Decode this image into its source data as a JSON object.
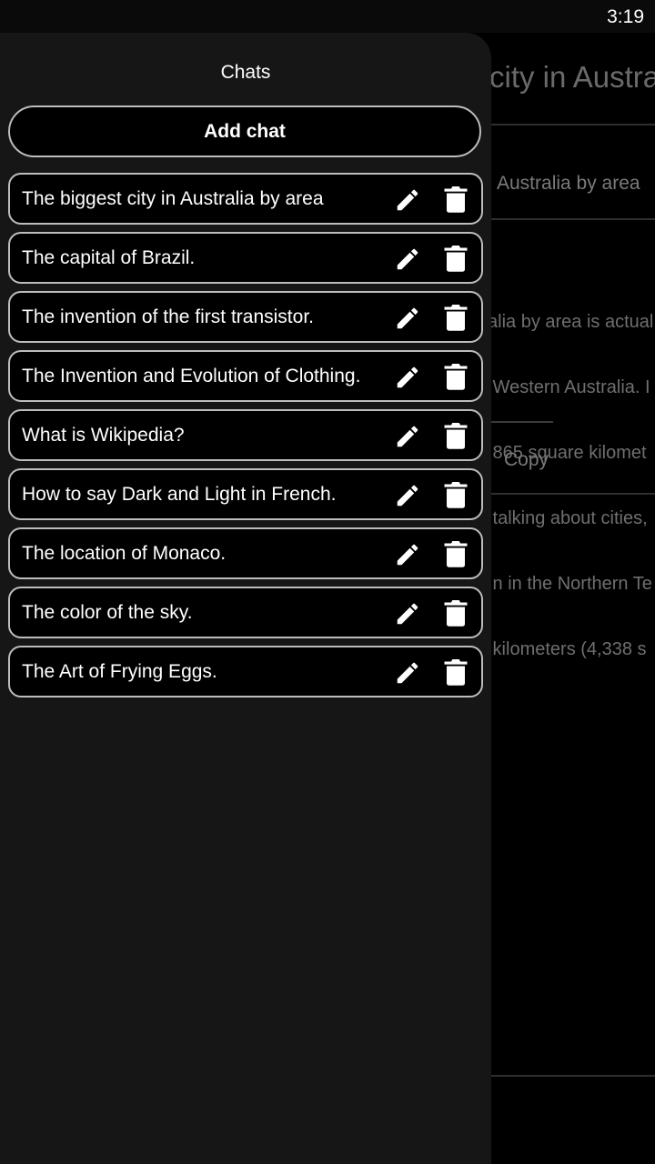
{
  "status": {
    "time": "3:19"
  },
  "background": {
    "title": "city in Austra",
    "question": "Australia by area",
    "answer_lines": [
      "alia by area is actual",
      " Western Australia. I",
      " 865 square kilomet",
      " talking about cities,",
      " n in the Northern Te",
      " kilometers (4,338 s"
    ],
    "copy_label": "Copy"
  },
  "drawer": {
    "title": "Chats",
    "add_chat_label": "Add chat",
    "chats": [
      {
        "label": "The biggest city in Australia by area",
        "edit_icon": "pencil-icon",
        "delete_icon": "trash-icon"
      },
      {
        "label": "The capital of Brazil.",
        "edit_icon": "pencil-icon",
        "delete_icon": "trash-icon"
      },
      {
        "label": "The invention of the first transistor.",
        "edit_icon": "pencil-icon",
        "delete_icon": "trash-icon"
      },
      {
        "label": "The Invention and Evolution of Clothing.",
        "edit_icon": "pencil-icon",
        "delete_icon": "trash-icon"
      },
      {
        "label": "What is Wikipedia?",
        "edit_icon": "pencil-icon",
        "delete_icon": "trash-icon"
      },
      {
        "label": "How to say Dark and Light in French.",
        "edit_icon": "pencil-icon",
        "delete_icon": "trash-icon"
      },
      {
        "label": "The location of Monaco.",
        "edit_icon": "pencil-icon",
        "delete_icon": "trash-icon"
      },
      {
        "label": "The color of the sky.",
        "edit_icon": "pencil-icon",
        "delete_icon": "trash-icon"
      },
      {
        "label": "The Art of Frying Eggs.",
        "edit_icon": "pencil-icon",
        "delete_icon": "trash-icon"
      }
    ]
  },
  "colors": {
    "drawer_bg": "#161616",
    "item_bg": "#000000",
    "item_border": "#bdbdbd",
    "text": "#ffffff"
  }
}
